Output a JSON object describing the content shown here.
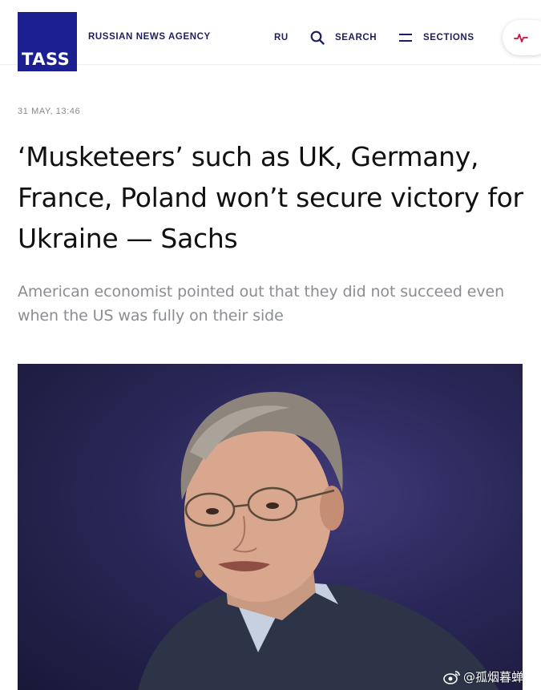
{
  "header": {
    "logo_text": "TASS",
    "agency_label": "RUSSIAN NEWS AGENCY",
    "nav": {
      "language": "RU",
      "search_label": "SEARCH",
      "sections_label": "SECTIONS"
    },
    "icons": [
      "search-icon",
      "menu-icon",
      "pulse-icon"
    ],
    "colors": {
      "brand": "#1b1f8f",
      "nav_text": "#1b1f5f",
      "pulse": "#d0103a"
    }
  },
  "article": {
    "date": "31 MAY, 13:46",
    "headline": "‘Musketeers’ such as UK, Germany, France, Poland won’t secure victory for Ukraine — Sachs",
    "lead": "American economist pointed out that they did not succeed even when the US was fully on their side"
  },
  "watermark": {
    "text": "@孤烟暮蝉",
    "icon": "weibo-icon"
  }
}
